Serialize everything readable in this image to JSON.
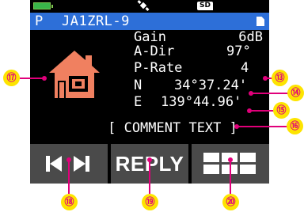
{
  "status_bar": {
    "battery_icon": "battery-full-icon",
    "gps_icon": "satellite-icon",
    "sd_label": "SD"
  },
  "title_bar": {
    "mode": "P",
    "callsign": "JA1ZRL-9",
    "document_icon": "document-icon"
  },
  "station": {
    "symbol_icon": "house-icon",
    "gain_label": "Gain",
    "gain_value": "6dB",
    "adir_label": "A-Dir",
    "adir_value": "97°",
    "prate_label": "P-Rate",
    "prate_value": "4",
    "lat_prefix": "N",
    "lat_value": "34°37.24'",
    "lon_prefix": "E",
    "lon_value": "139°44.96'",
    "comment": "[ COMMENT TEXT ]"
  },
  "softkeys": {
    "skip_icon": "skip-prev-next-icon",
    "reply_label": "REPLY",
    "menu_icon": "grid-menu-icon"
  },
  "callouts": {
    "c13": "⑬",
    "c14": "⑭",
    "c15": "⑮",
    "c16": "⑯",
    "c17": "⑰",
    "c18": "⑱",
    "c19": "⑲",
    "c20": "⑳"
  },
  "colors": {
    "title_bar": "#2d6fd8",
    "softkey": "#4a4a4a",
    "house": "#f08060",
    "callout_line": "#e0007a",
    "callout_badge": "#fde400"
  }
}
